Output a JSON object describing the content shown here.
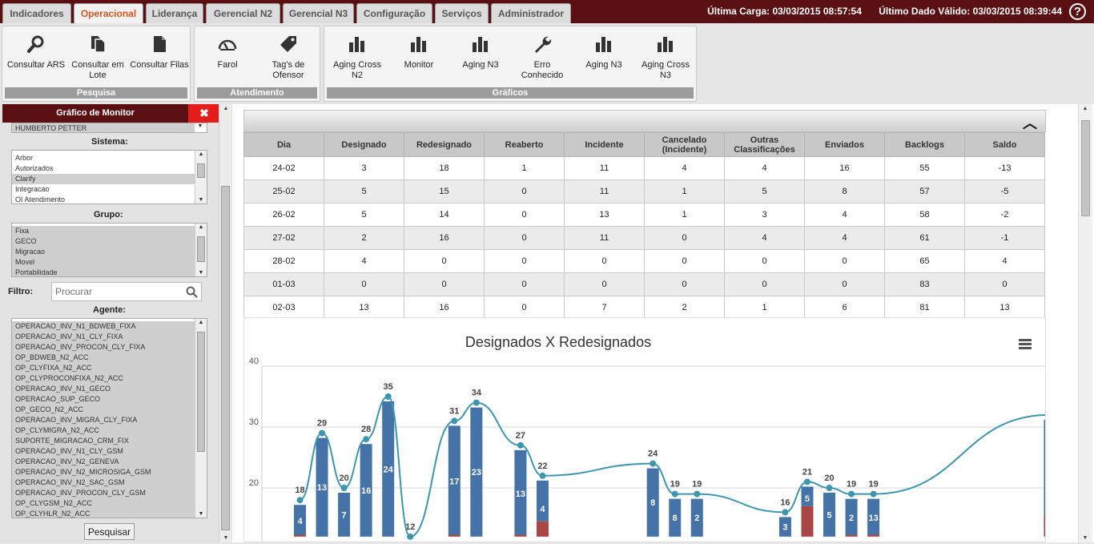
{
  "tabs": [
    {
      "label": "Indicadores",
      "active": false
    },
    {
      "label": "Operacional",
      "active": true
    },
    {
      "label": "Liderança",
      "active": false
    },
    {
      "label": "Gerencial N2",
      "active": false
    },
    {
      "label": "Gerencial N3",
      "active": false
    },
    {
      "label": "Configuração",
      "active": false
    },
    {
      "label": "Serviços",
      "active": false
    },
    {
      "label": "Administrador",
      "active": false
    }
  ],
  "status": {
    "ultima_carga": "Última Carga: 03/03/2015 08:57:54",
    "ultimo_dado": "Último Dado Válido: 03/03/2015 08:39:44",
    "help": "?"
  },
  "ribbon": {
    "groups": [
      {
        "title": "Pesquisa",
        "buttons": [
          {
            "label": "Consultar ARS",
            "icon": "search-icon"
          },
          {
            "label": "Consultar em Lote",
            "icon": "copy-icon"
          },
          {
            "label": "Consultar Filas",
            "icon": "document-icon"
          }
        ]
      },
      {
        "title": "Atendimento",
        "buttons": [
          {
            "label": "Farol",
            "icon": "gauge-icon"
          },
          {
            "label": "Tag's de Ofensor",
            "icon": "tag-icon"
          }
        ]
      },
      {
        "title": "Gráficos",
        "buttons": [
          {
            "label": "Aging Cross N2",
            "icon": "bar-chart-icon"
          },
          {
            "label": "Monitor",
            "icon": "bar-chart-icon"
          },
          {
            "label": "Aging N3",
            "icon": "bar-chart-icon"
          },
          {
            "label": "Erro Conhecido",
            "icon": "wrench-icon"
          },
          {
            "label": "Aging N3",
            "icon": "bar-chart-icon"
          },
          {
            "label": "Aging Cross N3",
            "icon": "bar-chart-icon"
          }
        ]
      }
    ]
  },
  "sidebar": {
    "title": "Gráfico de Monitor",
    "close": "✖",
    "top_item": "HUMBERTO PETTER",
    "sistema_label": "Sistema:",
    "sistema_items": [
      {
        "t": "Arbor",
        "s": false
      },
      {
        "t": "Autorizados",
        "s": false
      },
      {
        "t": "Clarify",
        "s": true
      },
      {
        "t": "Integracao",
        "s": false
      },
      {
        "t": "OI Atendimento",
        "s": false
      }
    ],
    "grupo_label": "Grupo:",
    "grupo_items": [
      {
        "t": "Fixa",
        "s": true
      },
      {
        "t": "GECO",
        "s": true
      },
      {
        "t": "Migracao",
        "s": true
      },
      {
        "t": "Movel",
        "s": true
      },
      {
        "t": "Portabilidade",
        "s": true
      }
    ],
    "filtro_label": "Filtro:",
    "filtro_placeholder": "Procurar",
    "agente_label": "Agente:",
    "agente_items": [
      "OPERACAO_INV_N1_BDWEB_FIXA",
      "OPERACAO_INV_N1_CLY_FIXA",
      "OPERACAO_INV_PROCON_CLY_FIXA",
      "OP_BDWEB_N2_ACC",
      "OP_CLYFIXA_N2_ACC",
      "OP_CLYPROCONFIXA_N2_ACC",
      "OPERACAO_INV_N1_GECO",
      "OPERACAO_SUP_GECO",
      "OP_GECO_N2_ACC",
      "OPERACAO_INV_MIGRA_CLY_FIXA",
      "OP_CLYMIGRA_N2_ACC",
      "SUPORTE_MIGRACAO_CRM_FIX",
      "OPERACAO_INV_N1_CLY_GSM",
      "OPERACAO_INV_N2_GENEVA",
      "OPERACAO_INV_N2_MICROSIGA_GSM",
      "OPERACAO_INV_N2_SAC_GSM",
      "OPERACAO_INV_PROCON_CLY_GSM",
      "OP_CLYGSM_N2_ACC",
      "OP_CLYHLR_N2_ACC"
    ],
    "button": "Pesquisar"
  },
  "table": {
    "headers": [
      "Dia",
      "Designado",
      "Redesignado",
      "Reaberto",
      "Incidente",
      "Cancelado (Incidente)",
      "Outras Classificações",
      "Enviados",
      "Backlogs",
      "Saldo"
    ],
    "rows": [
      [
        "24-02",
        "3",
        "18",
        "1",
        "11",
        "4",
        "4",
        "16",
        "55",
        "-13"
      ],
      [
        "25-02",
        "5",
        "15",
        "0",
        "11",
        "1",
        "5",
        "8",
        "57",
        "-5"
      ],
      [
        "26-02",
        "5",
        "14",
        "0",
        "13",
        "1",
        "3",
        "4",
        "58",
        "-2"
      ],
      [
        "27-02",
        "2",
        "16",
        "0",
        "11",
        "0",
        "4",
        "4",
        "61",
        "-1"
      ],
      [
        "28-02",
        "4",
        "0",
        "0",
        "0",
        "0",
        "0",
        "0",
        "65",
        "4"
      ],
      [
        "01-03",
        "0",
        "0",
        "0",
        "0",
        "0",
        "0",
        "0",
        "83",
        "0"
      ],
      [
        "02-03",
        "13",
        "16",
        "0",
        "7",
        "2",
        "1",
        "6",
        "81",
        "13"
      ]
    ]
  },
  "chart_data": {
    "type": "bar",
    "title": "Designados X Redesignados",
    "ylim": [
      12,
      40
    ],
    "yticks": [
      20,
      30,
      40
    ],
    "menu_icon": "hamburger-menu-icon",
    "colors": {
      "blue": "#4572a7",
      "red": "#aa4643",
      "line": "#3d96ae"
    },
    "stacks": [
      {
        "blue": 4,
        "red": 0.3,
        "total": 18
      },
      {
        "blue": 13,
        "red": 0,
        "total": 29
      },
      {
        "blue": 7,
        "red": 0,
        "total": 20
      },
      {
        "blue": 16,
        "red": 0,
        "total": 28
      },
      {
        "blue": 24,
        "red": 0,
        "total": 35
      },
      {
        "blue": 0,
        "red": 0,
        "total": 12
      },
      {
        "blue": null,
        "red": null,
        "total": null
      },
      {
        "blue": 17,
        "red": 0.3,
        "total": 31
      },
      {
        "blue": 23,
        "red": 0,
        "total": 34
      },
      {
        "blue": null,
        "red": null,
        "total": null
      },
      {
        "blue": 13,
        "red": 0.3,
        "total": 27
      },
      {
        "blue": 4,
        "red": 2.5,
        "total": 22
      },
      {
        "blue": null,
        "red": null,
        "total": null
      },
      {
        "blue": null,
        "red": null,
        "total": null
      },
      {
        "blue": null,
        "red": null,
        "total": null
      },
      {
        "blue": null,
        "red": null,
        "total": null
      },
      {
        "blue": 7,
        "red": 0,
        "total": 24
      },
      {
        "blue": 8,
        "red": 0,
        "total": 19
      },
      {
        "blue": 8,
        "red": 0,
        "total": 19
      },
      {
        "blue": null,
        "red": null,
        "total": null
      },
      {
        "blue": null,
        "red": null,
        "total": null
      },
      {
        "blue": null,
        "red": null,
        "total": null
      },
      {
        "blue": 2,
        "red": 0,
        "total": 16
      },
      {
        "blue": 3,
        "red": 5,
        "total": 21
      },
      {
        "blue": 5,
        "red": 0,
        "total": 20
      },
      {
        "blue": 5,
        "red": 0.3,
        "total": 19
      },
      {
        "blue": 2,
        "red": 0.3,
        "total": 19
      },
      {
        "blue": null,
        "red": null,
        "total": null
      },
      {
        "blue": null,
        "red": null,
        "total": null
      },
      {
        "blue": null,
        "red": null,
        "total": null
      },
      {
        "blue": null,
        "red": null,
        "total": null
      },
      {
        "blue": null,
        "red": null,
        "total": null
      },
      {
        "blue": null,
        "red": null,
        "total": null
      },
      {
        "blue": null,
        "red": null,
        "total": null
      },
      {
        "blue": 13,
        "red": 3.5,
        "total": 32
      }
    ],
    "bar_labels_shown": [
      "4",
      "13",
      "7",
      "16",
      "24",
      "17",
      "23",
      "13",
      "4",
      "8",
      "8",
      "2",
      "3",
      "5",
      "5",
      "2",
      "13"
    ]
  }
}
